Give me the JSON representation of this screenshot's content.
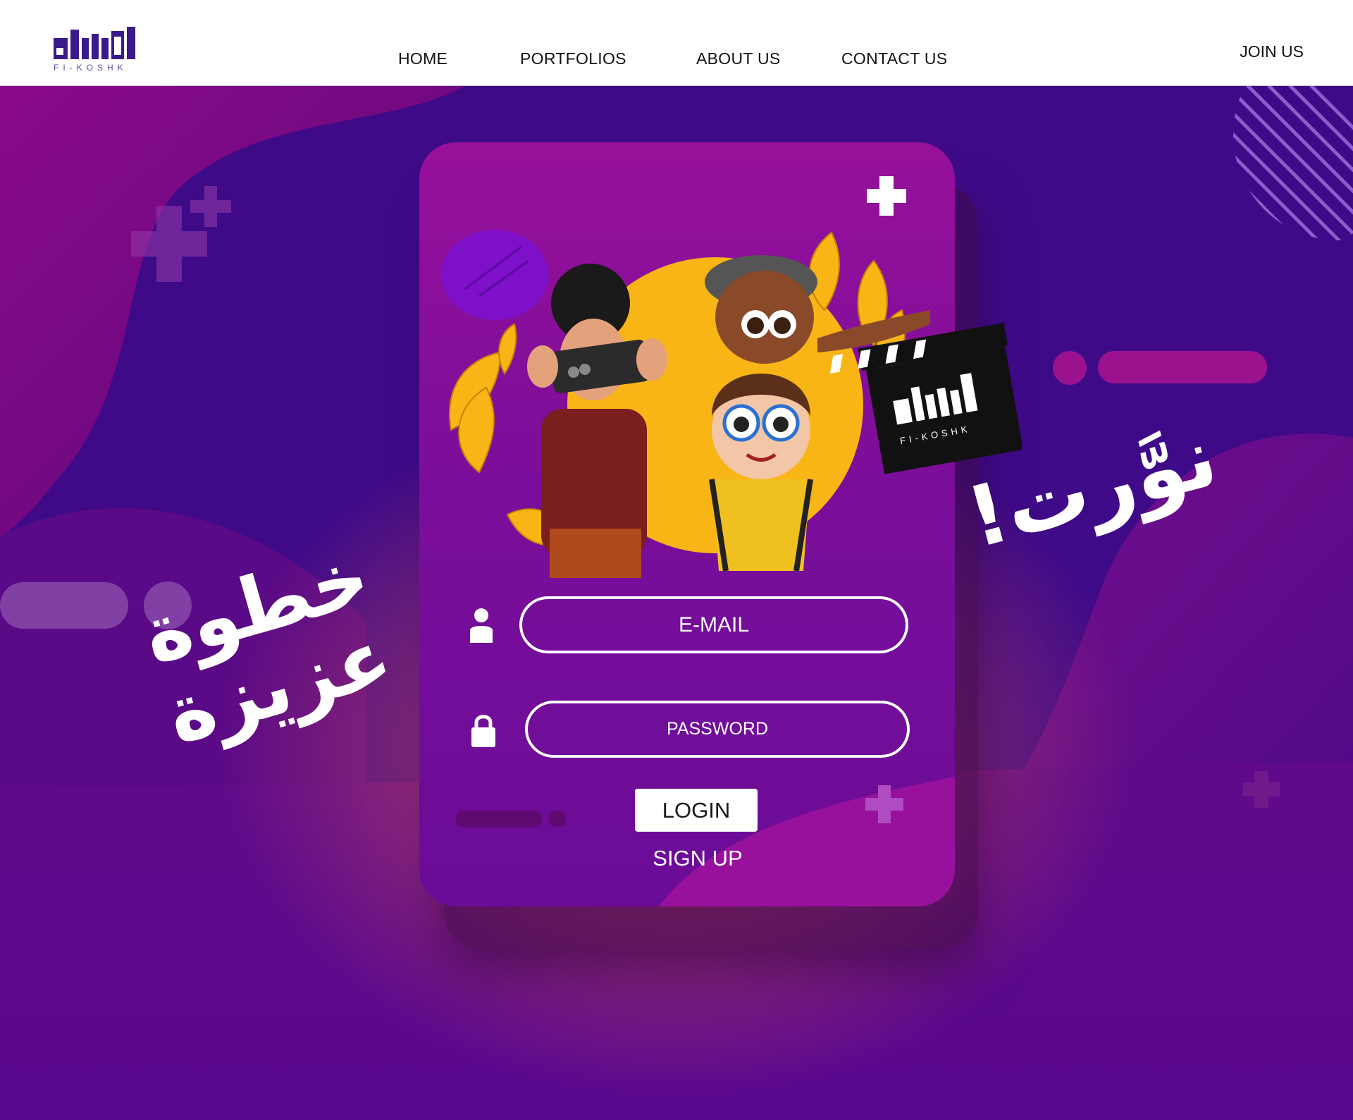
{
  "header": {
    "logo_text": "FI-KOSHK",
    "nav": [
      "HOME",
      "PORTFOLIOS",
      "ABOUT US",
      "CONTACT US"
    ],
    "join_label": "JOIN US"
  },
  "login": {
    "email_placeholder": "E-MAIL",
    "password_placeholder": "PASSWORD",
    "login_label": "LOGIN",
    "signup_label": "SIGN UP"
  },
  "clapper_logo_text": "FI-KOSHK",
  "arabic_left": "خطوة عزيزة",
  "arabic_right": "نوَّرت!",
  "colors": {
    "background": "#4a0a8c",
    "card": "#8a10a0",
    "accent_yellow": "#f8b515",
    "white": "#ffffff"
  },
  "icons": [
    "user-icon",
    "lock-icon",
    "plus-icon",
    "clapperboard-icon"
  ]
}
